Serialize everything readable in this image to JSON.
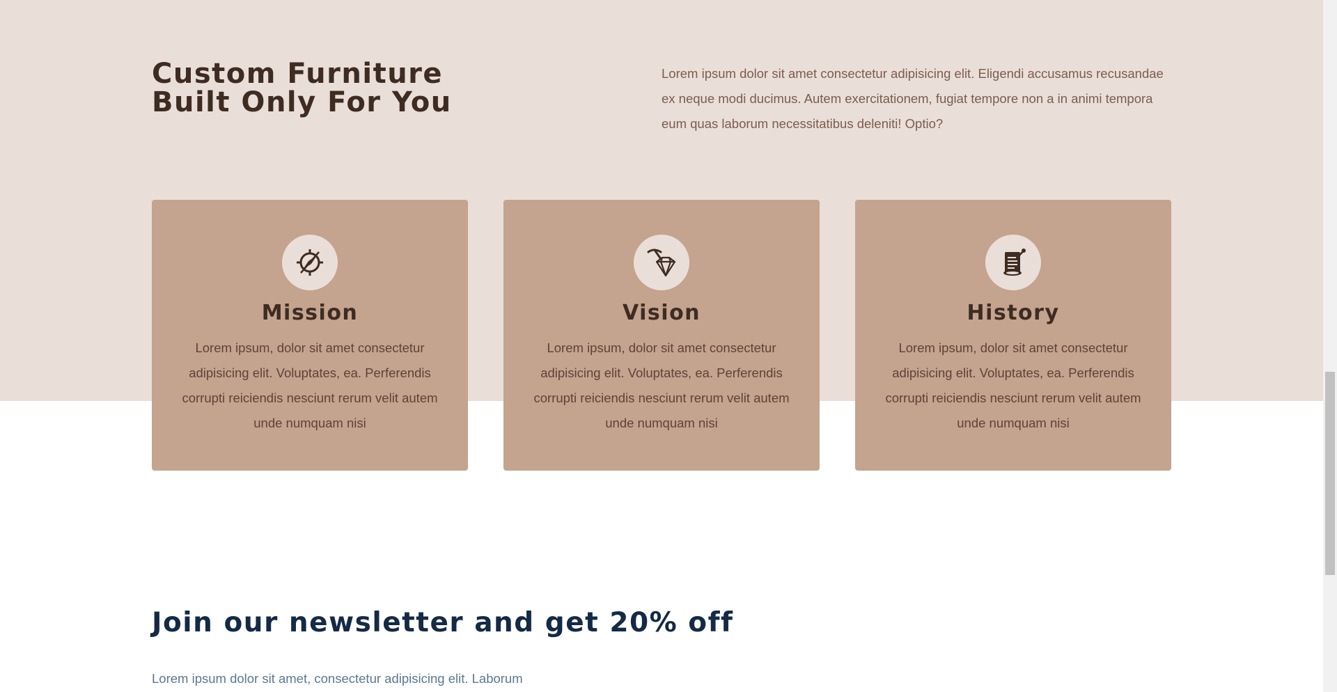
{
  "about": {
    "title_line1": "Custom Furniture",
    "title_line2": "Built Only For You",
    "text": "Lorem ipsum dolor sit amet consectetur adipisicing elit. Eligendi accusamus recusandae ex neque modi ducimus. Autem exercitationem, fugiat tempore non a in animi tempora eum quas laborum necessitatibus deleniti! Optio?"
  },
  "cards": [
    {
      "icon": "compass-icon",
      "title": "Mission",
      "text": "Lorem ipsum, dolor sit amet consectetur adipisicing elit. Voluptates, ea. Perferendis corrupti reiciendis nesciunt rerum velit autem unde numquam nisi"
    },
    {
      "icon": "diamond-pickaxe-icon",
      "title": "Vision",
      "text": "Lorem ipsum, dolor sit amet consectetur adipisicing elit. Voluptates, ea. Perferendis corrupti reiciendis nesciunt rerum velit autem unde numquam nisi"
    },
    {
      "icon": "scroll-document-icon",
      "title": "History",
      "text": "Lorem ipsum, dolor sit amet consectetur adipisicing elit. Voluptates, ea. Perferendis corrupti reiciendis nesciunt rerum velit autem unde numquam nisi"
    }
  ],
  "newsletter": {
    "title": "Join our newsletter and get 20% off",
    "text": "Lorem ipsum dolor sit amet, consectetur adipisicing elit. Laborum"
  },
  "colors": {
    "section_bg": "#eaded8",
    "card_bg": "#c4a38f",
    "heading_brown": "#3e2c22",
    "newsletter_heading": "#142a45"
  }
}
